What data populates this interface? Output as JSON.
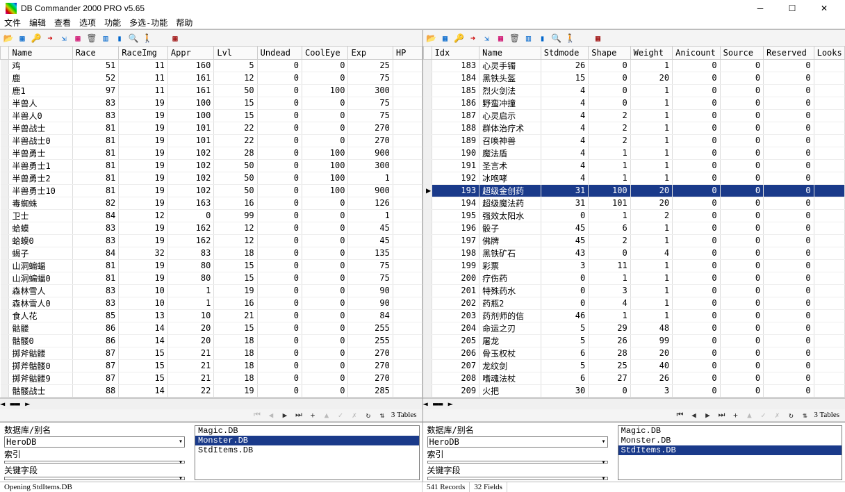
{
  "window": {
    "title": "DB Commander 2000 PRO v5.65"
  },
  "menu": [
    "文件",
    "编辑",
    "查看",
    "选项",
    "功能",
    "多选-功能",
    "帮助"
  ],
  "toolbar_icons": [
    {
      "n": "open-icon",
      "g": "📂",
      "c": "#c90"
    },
    {
      "n": "grid-icon",
      "g": "▦",
      "c": "#06c"
    },
    {
      "n": "key-icon",
      "g": "🔑",
      "c": "#c90"
    },
    {
      "n": "red-arrow-icon",
      "g": "➜",
      "c": "#c00"
    },
    {
      "n": "blue-import-icon",
      "g": "⇲",
      "c": "#06c"
    },
    {
      "n": "table-red-icon",
      "g": "▦",
      "c": "#c06"
    },
    {
      "n": "trash-icon",
      "g": "🗑",
      "c": "#555"
    },
    {
      "n": "box-icon",
      "g": "▥",
      "c": "#06c"
    },
    {
      "n": "blue-bar-icon",
      "g": "▮",
      "c": "#06c"
    },
    {
      "n": "search-icon",
      "g": "🔍",
      "c": "#06c"
    },
    {
      "n": "run-icon",
      "g": "🚶",
      "c": "#0a0"
    },
    {
      "n": "spacer",
      "g": ""
    },
    {
      "n": "exit-icon",
      "g": "▦",
      "c": "#900"
    }
  ],
  "left": {
    "columns": [
      "Name",
      "Race",
      "RaceImg",
      "Appr",
      "Lvl",
      "Undead",
      "CoolEye",
      "Exp",
      "HP"
    ],
    "rows": [
      [
        "鸡",
        51,
        11,
        160,
        5,
        0,
        0,
        25,
        ""
      ],
      [
        "鹿",
        52,
        11,
        161,
        12,
        0,
        0,
        75,
        ""
      ],
      [
        "鹿1",
        97,
        11,
        161,
        50,
        0,
        100,
        300,
        ""
      ],
      [
        "半兽人",
        83,
        19,
        100,
        15,
        0,
        0,
        75,
        ""
      ],
      [
        "半兽人0",
        83,
        19,
        100,
        15,
        0,
        0,
        75,
        ""
      ],
      [
        "半兽战士",
        81,
        19,
        101,
        22,
        0,
        0,
        270,
        ""
      ],
      [
        "半兽战士0",
        81,
        19,
        101,
        22,
        0,
        0,
        270,
        ""
      ],
      [
        "半兽勇士",
        81,
        19,
        102,
        28,
        0,
        100,
        900,
        ""
      ],
      [
        "半兽勇士1",
        81,
        19,
        102,
        50,
        0,
        100,
        300,
        ""
      ],
      [
        "半兽勇士2",
        81,
        19,
        102,
        50,
        0,
        100,
        1,
        ""
      ],
      [
        "半兽勇士10",
        81,
        19,
        102,
        50,
        0,
        100,
        900,
        ""
      ],
      [
        "毒蜘蛛",
        82,
        19,
        163,
        16,
        0,
        0,
        126,
        ""
      ],
      [
        "卫士",
        84,
        12,
        0,
        99,
        0,
        0,
        1,
        ""
      ],
      [
        "蛤蟆",
        83,
        19,
        162,
        12,
        0,
        0,
        45,
        ""
      ],
      [
        "蛤蟆0",
        83,
        19,
        162,
        12,
        0,
        0,
        45,
        ""
      ],
      [
        "蝎子",
        84,
        32,
        83,
        18,
        0,
        0,
        135,
        ""
      ],
      [
        "山洞蝙蝠",
        81,
        19,
        80,
        15,
        0,
        0,
        75,
        ""
      ],
      [
        "山洞蝙蝠0",
        81,
        19,
        80,
        15,
        0,
        0,
        75,
        ""
      ],
      [
        "森林雪人",
        83,
        10,
        1,
        19,
        0,
        0,
        90,
        ""
      ],
      [
        "森林雪人0",
        83,
        10,
        1,
        16,
        0,
        0,
        90,
        ""
      ],
      [
        "食人花",
        85,
        13,
        10,
        21,
        0,
        0,
        84,
        ""
      ],
      [
        "骷髅",
        86,
        14,
        20,
        15,
        0,
        0,
        255,
        ""
      ],
      [
        "骷髅0",
        86,
        14,
        20,
        18,
        0,
        0,
        255,
        ""
      ],
      [
        "掷斧骷髅",
        87,
        15,
        21,
        18,
        0,
        0,
        270,
        ""
      ],
      [
        "掷斧骷髅0",
        87,
        15,
        21,
        18,
        0,
        0,
        270,
        ""
      ],
      [
        "掷斧骷髅9",
        87,
        15,
        21,
        18,
        0,
        0,
        270,
        ""
      ],
      [
        "骷髅战士",
        88,
        14,
        22,
        19,
        0,
        0,
        285,
        ""
      ]
    ],
    "nav_tables": "3 Tables",
    "db_label": "数据库/别名",
    "db_value": "HeroDB",
    "idx_label": "索引",
    "idx_value": "",
    "key_label": "关键字段",
    "key_value": "",
    "files": [
      {
        "name": "Magic.DB",
        "sel": false
      },
      {
        "name": "Monster.DB",
        "sel": true
      },
      {
        "name": "StdItems.DB",
        "sel": false
      }
    ]
  },
  "right": {
    "columns": [
      "Idx",
      "Name",
      "Stdmode",
      "Shape",
      "Weight",
      "Anicount",
      "Source",
      "Reserved",
      "Looks"
    ],
    "selected_idx": 193,
    "rows": [
      [
        183,
        "心灵手镯",
        26,
        0,
        1,
        0,
        0,
        0,
        ""
      ],
      [
        184,
        "黑铁头盔",
        15,
        0,
        20,
        0,
        0,
        0,
        ""
      ],
      [
        185,
        "烈火剑法",
        4,
        0,
        1,
        0,
        0,
        0,
        ""
      ],
      [
        186,
        "野蛮冲撞",
        4,
        0,
        1,
        0,
        0,
        0,
        ""
      ],
      [
        187,
        "心灵启示",
        4,
        2,
        1,
        0,
        0,
        0,
        ""
      ],
      [
        188,
        "群体治疗术",
        4,
        2,
        1,
        0,
        0,
        0,
        ""
      ],
      [
        189,
        "召唤神兽",
        4,
        2,
        1,
        0,
        0,
        0,
        ""
      ],
      [
        190,
        "魔法盾",
        4,
        1,
        1,
        0,
        0,
        0,
        ""
      ],
      [
        191,
        "圣言术",
        4,
        1,
        1,
        0,
        0,
        0,
        ""
      ],
      [
        192,
        "冰咆哮",
        4,
        1,
        1,
        0,
        0,
        0,
        ""
      ],
      [
        193,
        "超级金创药",
        31,
        100,
        20,
        0,
        0,
        0,
        ""
      ],
      [
        194,
        "超级魔法药",
        31,
        101,
        20,
        0,
        0,
        0,
        ""
      ],
      [
        195,
        "强效太阳水",
        0,
        1,
        2,
        0,
        0,
        0,
        ""
      ],
      [
        196,
        "骰子",
        45,
        6,
        1,
        0,
        0,
        0,
        ""
      ],
      [
        197,
        "佛牌",
        45,
        2,
        1,
        0,
        0,
        0,
        ""
      ],
      [
        198,
        "黑铁矿石",
        43,
        0,
        4,
        0,
        0,
        0,
        ""
      ],
      [
        199,
        "彩票",
        3,
        11,
        1,
        0,
        0,
        0,
        ""
      ],
      [
        200,
        "疗伤药",
        0,
        1,
        1,
        0,
        0,
        0,
        ""
      ],
      [
        201,
        "特殊药水",
        0,
        3,
        1,
        0,
        0,
        0,
        ""
      ],
      [
        202,
        "药瓶2",
        0,
        4,
        1,
        0,
        0,
        0,
        ""
      ],
      [
        203,
        "药剂师的信",
        46,
        1,
        1,
        0,
        0,
        0,
        ""
      ],
      [
        204,
        "命运之刃",
        5,
        29,
        48,
        0,
        0,
        0,
        ""
      ],
      [
        205,
        "屠龙",
        5,
        26,
        99,
        0,
        0,
        0,
        ""
      ],
      [
        206,
        "骨玉权杖",
        6,
        28,
        20,
        0,
        0,
        0,
        ""
      ],
      [
        207,
        "龙纹剑",
        5,
        25,
        40,
        0,
        0,
        0,
        ""
      ],
      [
        208,
        "嗜魂法杖",
        6,
        27,
        26,
        0,
        0,
        0,
        ""
      ],
      [
        209,
        "火把",
        30,
        0,
        3,
        0,
        0,
        0,
        ""
      ]
    ],
    "nav_tables": "3 Tables",
    "db_label": "数据库/别名",
    "db_value": "HeroDB",
    "idx_label": "索引",
    "idx_value": "",
    "key_label": "关键字段",
    "key_value": "",
    "files": [
      {
        "name": "Magic.DB",
        "sel": false
      },
      {
        "name": "Monster.DB",
        "sel": false
      },
      {
        "name": "StdItems.DB",
        "sel": true
      }
    ]
  },
  "status": {
    "left": "Opening StdItems.DB",
    "records": "541 Records",
    "fields": "32 Fields"
  }
}
